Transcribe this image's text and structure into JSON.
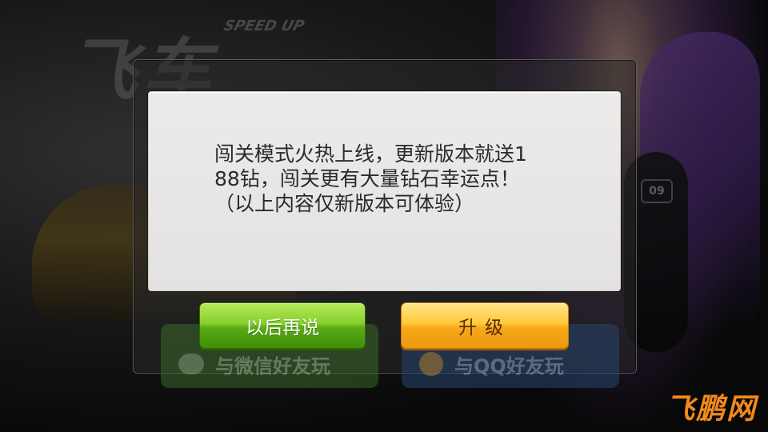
{
  "background": {
    "logo_text": "飞车",
    "logo_subtext": "SPEED UP",
    "arm_badge": "09"
  },
  "share": {
    "wechat_label": "与微信好友玩",
    "qq_label": "与QQ好友玩"
  },
  "dialog": {
    "message_lines": [
      "闯关模式火热上线，更新版本就送1",
      "88钻，闯关更有大量钻石幸运点！",
      "（以上内容仅新版本可体验）"
    ]
  },
  "buttons": {
    "later_label": "以后再说",
    "upgrade_label": "升级"
  },
  "watermark": {
    "text": "飞鹏网"
  },
  "colors": {
    "later_button": "#6cbf1e",
    "upgrade_button": "#fbb62a",
    "watermark": "#f08a1a"
  }
}
